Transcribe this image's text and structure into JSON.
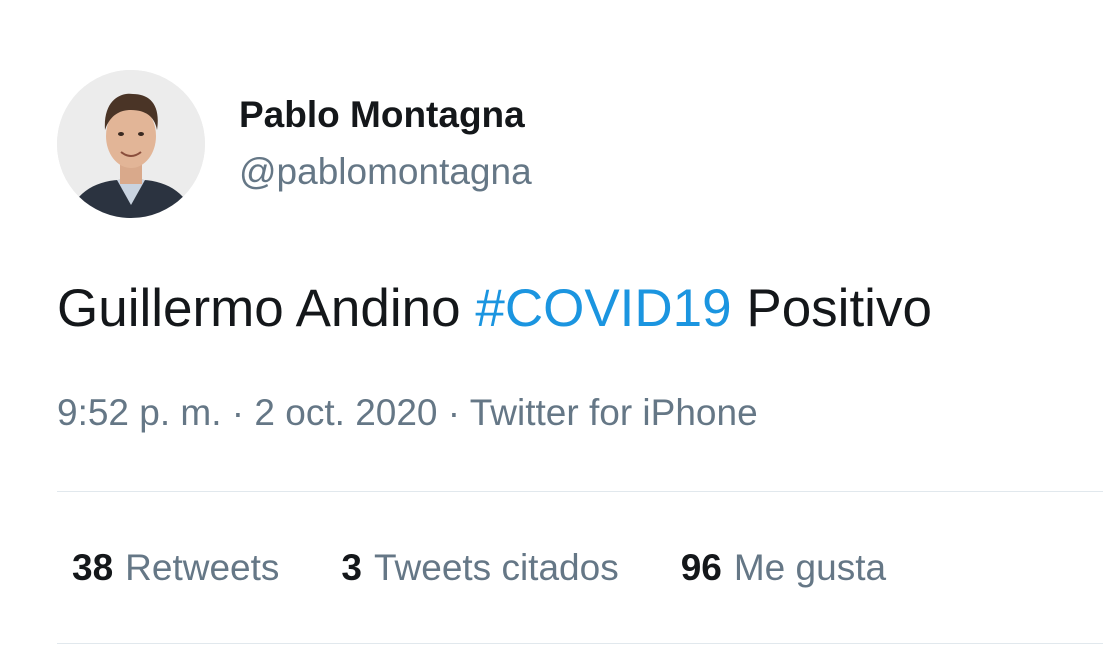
{
  "author": {
    "display_name": "Pablo Montagna",
    "handle": "@pablomontagna"
  },
  "tweet": {
    "text_before": "Guillermo Andino ",
    "hashtag": "#COVID19",
    "text_after": " Positivo"
  },
  "meta": {
    "time": "9:52 p. m.",
    "separator1": " · ",
    "date": "2 oct. 2020",
    "separator2": " · ",
    "source": "Twitter for iPhone"
  },
  "stats": {
    "retweets": {
      "count": "38",
      "label": "Retweets"
    },
    "quotes": {
      "count": "3",
      "label": "Tweets citados"
    },
    "likes": {
      "count": "96",
      "label": "Me gusta"
    }
  },
  "colors": {
    "hashtag": "#1b95e0",
    "secondary_text": "#657786",
    "primary_text": "#14171a",
    "divider": "#e1e8ed"
  }
}
